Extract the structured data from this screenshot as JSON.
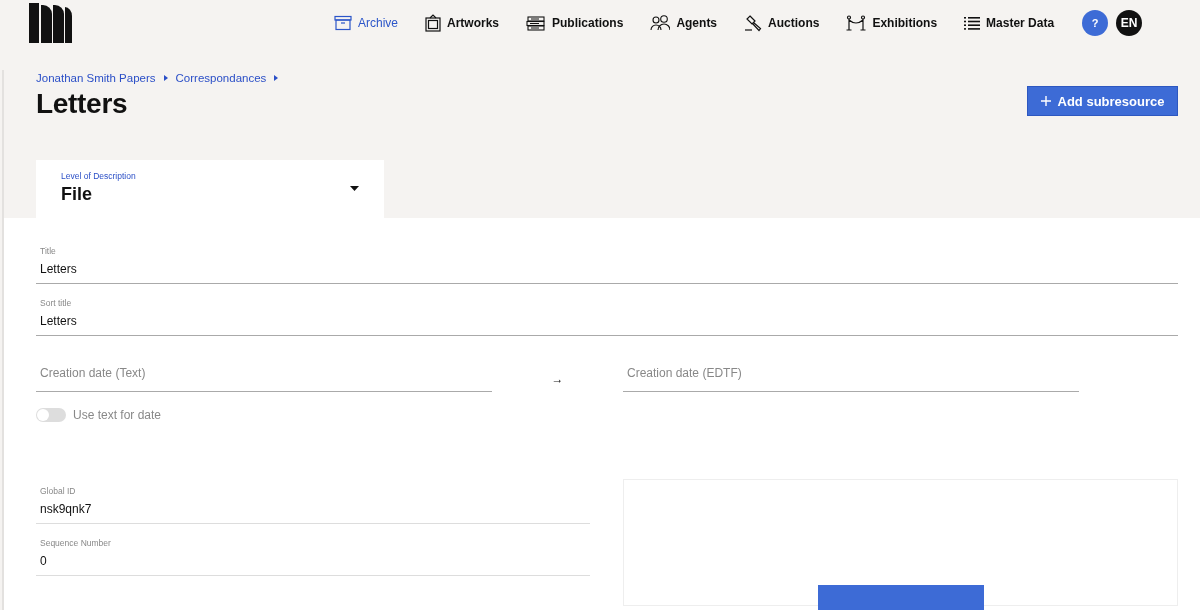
{
  "nav": {
    "items": [
      {
        "label": "Archive",
        "selected": true
      },
      {
        "label": "Artworks",
        "selected": false
      },
      {
        "label": "Publications",
        "selected": false
      },
      {
        "label": "Agents",
        "selected": false
      },
      {
        "label": "Auctions",
        "selected": false
      },
      {
        "label": "Exhibitions",
        "selected": false
      },
      {
        "label": "Master Data",
        "selected": false
      }
    ],
    "help": "?",
    "language": "EN"
  },
  "breadcrumb": [
    "Jonathan Smith Papers",
    "Correspondances"
  ],
  "page_title": "Letters",
  "add_button": "Add subresource",
  "level_of_description": {
    "label": "Level of Description",
    "value": "File"
  },
  "fields": [
    {
      "label": "Title",
      "value": "Letters"
    },
    {
      "label": "Sort title",
      "value": "Letters"
    }
  ],
  "date_fields": [
    {
      "placeholder": "Creation date (Text)"
    },
    {
      "placeholder": "Creation date (EDTF)"
    }
  ],
  "date_arrow": "→",
  "use_text_toggle": {
    "label": "Use text for date",
    "on": false
  },
  "lower_fields": [
    {
      "label": "Global ID",
      "value": "nsk9qnk7"
    },
    {
      "label": "Sequence Number",
      "value": "0"
    }
  ]
}
